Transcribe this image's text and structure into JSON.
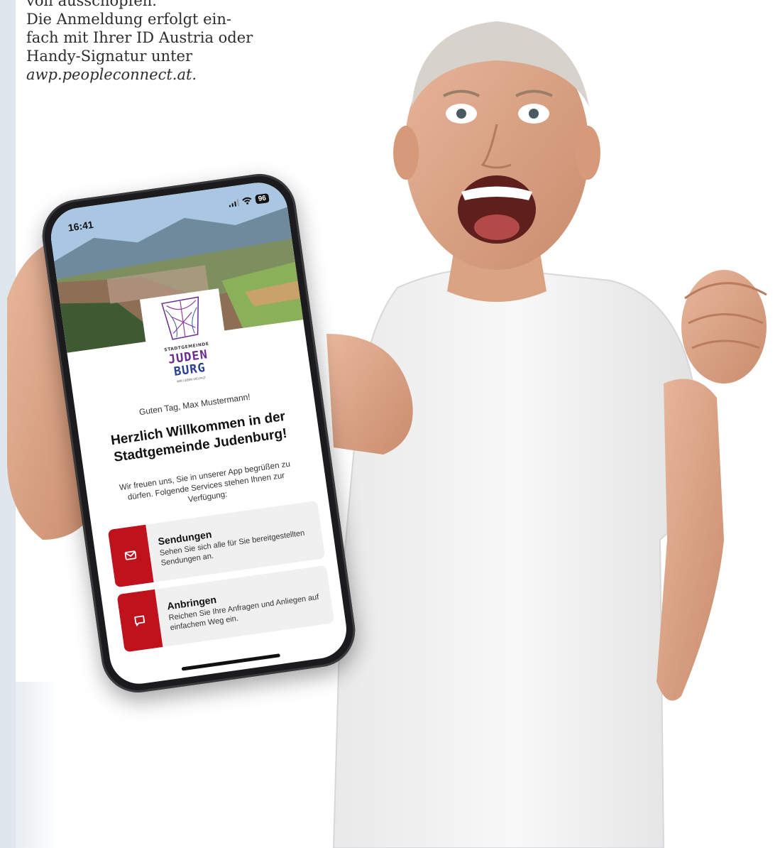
{
  "article": {
    "lines": [
      "voll ausschöpfen.",
      "Die Anmeldung erfolgt ein-",
      "fach mit Ihrer ID Austria oder",
      "Handy-Signatur unter",
      "awp.peopleconnect.at."
    ]
  },
  "phone": {
    "status": {
      "time": "16:41",
      "battery": "96"
    },
    "logo": {
      "small": "STADTGEMEINDE",
      "line1": "JUDEN",
      "line2": "BURG",
      "slogan": "WIR LEBEN VIELFALT"
    },
    "greeting": "Guten Tag, Max Mustermann!",
    "headline_1": "Herzlich Willkommen in der",
    "headline_2": "Stadtgemeinde Judenburg!",
    "intro": "Wir freuen uns, Sie in unserer App begrüßen zu dürfen. Folgende Services stehen Ihnen zur Verfügung:",
    "services": [
      {
        "icon": "mail-icon",
        "title": "Sendungen",
        "desc": "Sehen Sie sich alle für Sie bereitgestellten Sendungen an."
      },
      {
        "icon": "chat-icon",
        "title": "Anbringen",
        "desc": "Reichen Sie Ihre Anfragen und Anliegen auf einfachem Weg ein."
      }
    ]
  },
  "colors": {
    "accent": "#c0121c",
    "left_strip": "#dfe6ec"
  }
}
